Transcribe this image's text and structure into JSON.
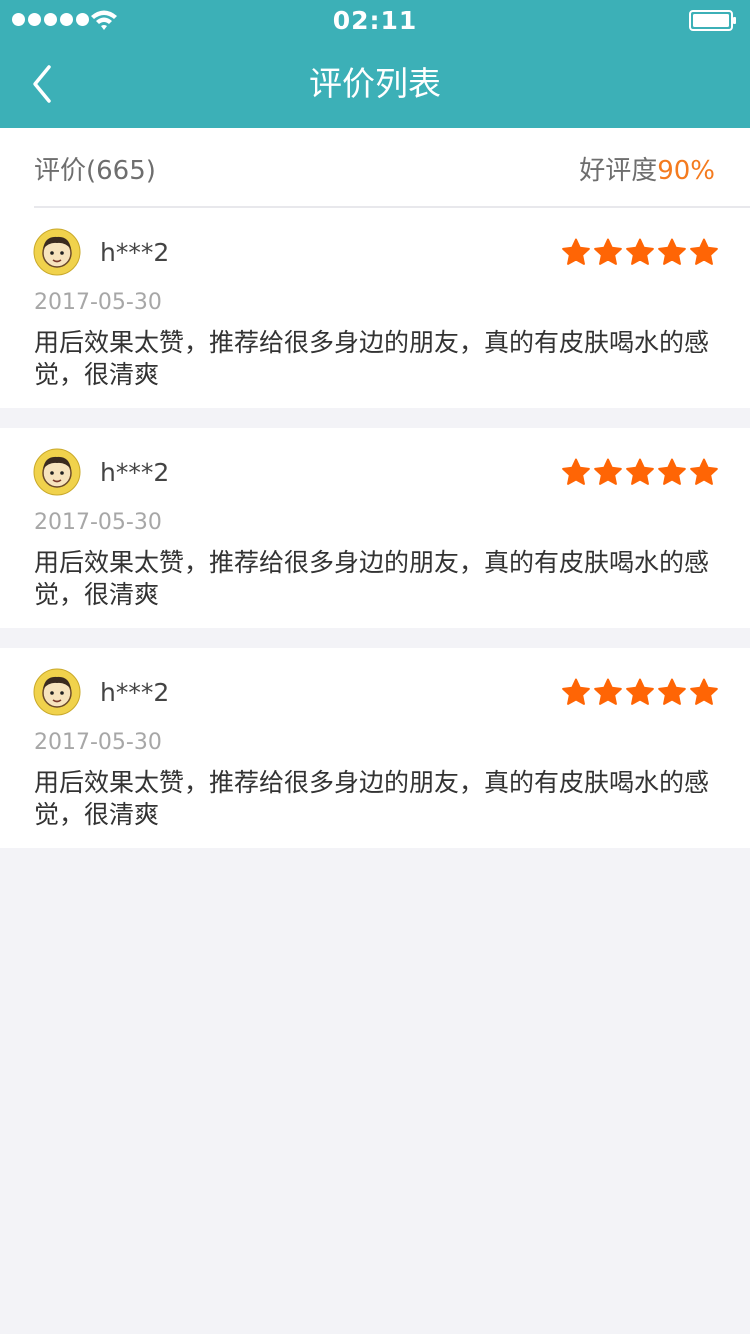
{
  "status_bar": {
    "time": "02:11"
  },
  "nav": {
    "title": "评价列表",
    "back_icon": "chevron-left-icon"
  },
  "summary": {
    "count_label": "评价(665)",
    "rate_label": "好评度",
    "rate_value": "90%"
  },
  "colors": {
    "header": "#3cb0b7",
    "accent_orange": "#f47b1f",
    "star": "#ff6505",
    "background": "#f3f3f7"
  },
  "reviews": [
    {
      "user": "h***2",
      "rating": 5,
      "date": "2017-05-30",
      "content": "用后效果太赞，推荐给很多身边的朋友，真的有皮肤喝水的感觉，很清爽"
    },
    {
      "user": "h***2",
      "rating": 5,
      "date": "2017-05-30",
      "content": "用后效果太赞，推荐给很多身边的朋友，真的有皮肤喝水的感觉，很清爽"
    },
    {
      "user": "h***2",
      "rating": 5,
      "date": "2017-05-30",
      "content": "用后效果太赞，推荐给很多身边的朋友，真的有皮肤喝水的感觉，很清爽"
    }
  ]
}
